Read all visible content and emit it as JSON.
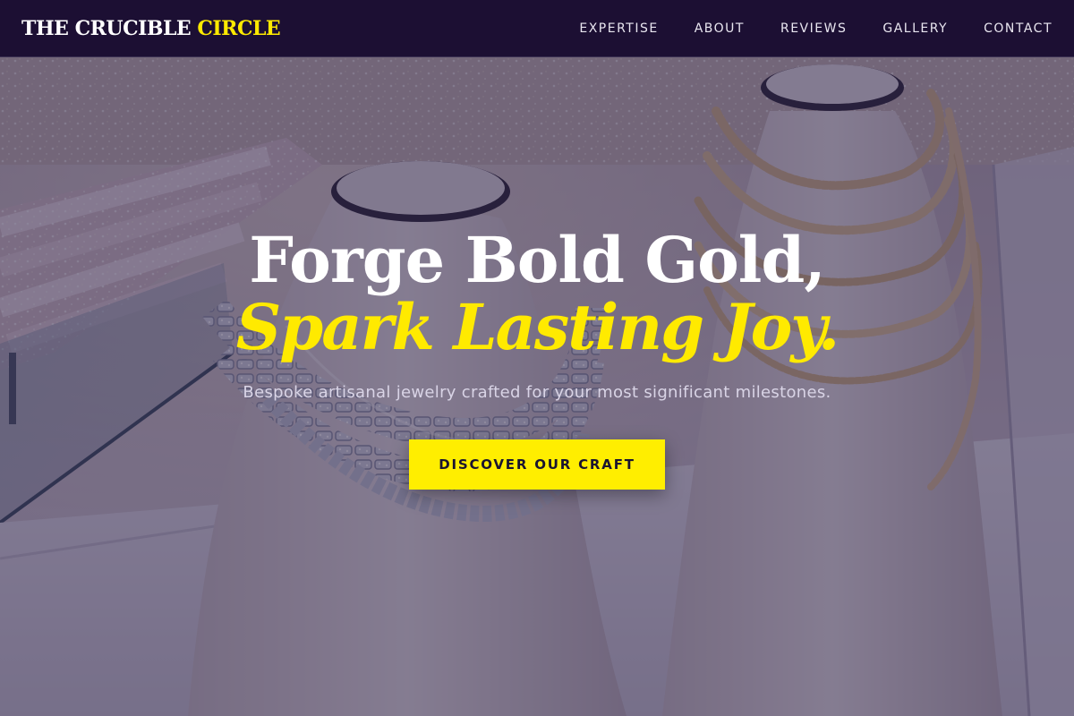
{
  "brand": {
    "name_main": "THE CRUCIBLE ",
    "name_accent": "CIRCLE"
  },
  "nav": {
    "items": [
      {
        "label": "EXPERTISE"
      },
      {
        "label": "ABOUT"
      },
      {
        "label": "REVIEWS"
      },
      {
        "label": "GALLERY"
      },
      {
        "label": "CONTACT"
      }
    ]
  },
  "hero": {
    "headline_line1": "Forge Bold Gold,",
    "headline_line2": "Spark Lasting Joy.",
    "subtitle": "Bespoke artisanal jewelry crafted for your most significant milestones.",
    "cta_label": "DISCOVER OUR CRAFT",
    "background_image": "jewelry-display-photo"
  },
  "colors": {
    "nav_bg": "#1c0f33",
    "accent": "#ffea00",
    "cta_bg": "#ffee00",
    "headline": "#ffffff",
    "subtitle": "#d9d4e6"
  }
}
